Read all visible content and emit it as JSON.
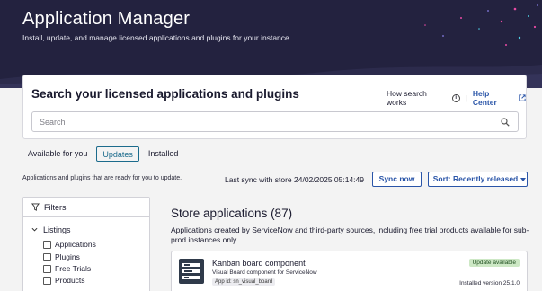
{
  "header": {
    "title": "Application Manager",
    "subtitle": "Install, update, and manage licensed applications and plugins for your instance."
  },
  "search": {
    "heading": "Search your licensed applications and plugins",
    "how_search_works": "How search works",
    "separator": "|",
    "help_center": "Help Center",
    "placeholder": "Search",
    "value": ""
  },
  "tabs": [
    {
      "label": "Available for you",
      "active": false
    },
    {
      "label": "Updates",
      "active": true
    },
    {
      "label": "Installed",
      "active": false
    }
  ],
  "toolbar": {
    "info": "Applications and plugins that are ready for you to update.",
    "last_sync": "Last sync with store  24/02/2025 05:14:49",
    "sync_button": "Sync now",
    "sort_button": "Sort: Recently released"
  },
  "filters": {
    "title": "Filters",
    "group": "Listings",
    "options": [
      "Applications",
      "Plugins",
      "Free Trials",
      "Products"
    ]
  },
  "store": {
    "title": "Store applications (87)",
    "description": "Applications created by ServiceNow and third-party sources, including free trial products available for sub-prod instances only."
  },
  "app_card": {
    "name": "Kanban board component",
    "description": "Visual Board component for ServiceNow",
    "app_id": "App id: sn_visual_board",
    "badge": "Update available",
    "version": "Installed version 25.1.0"
  },
  "icons": {
    "info": "info-icon",
    "external_link": "external-link-icon",
    "search": "search-icon",
    "filter": "funnel-icon",
    "chevron": "chevron-down-icon",
    "sort_caret": "caret-down-icon",
    "app_logo": "kanban-board-icon"
  },
  "colors": {
    "hero_bg": "#23223f",
    "accent": "#2a55a8",
    "active_tab": "#1b6b8c",
    "badge_bg": "#cde8c5"
  }
}
